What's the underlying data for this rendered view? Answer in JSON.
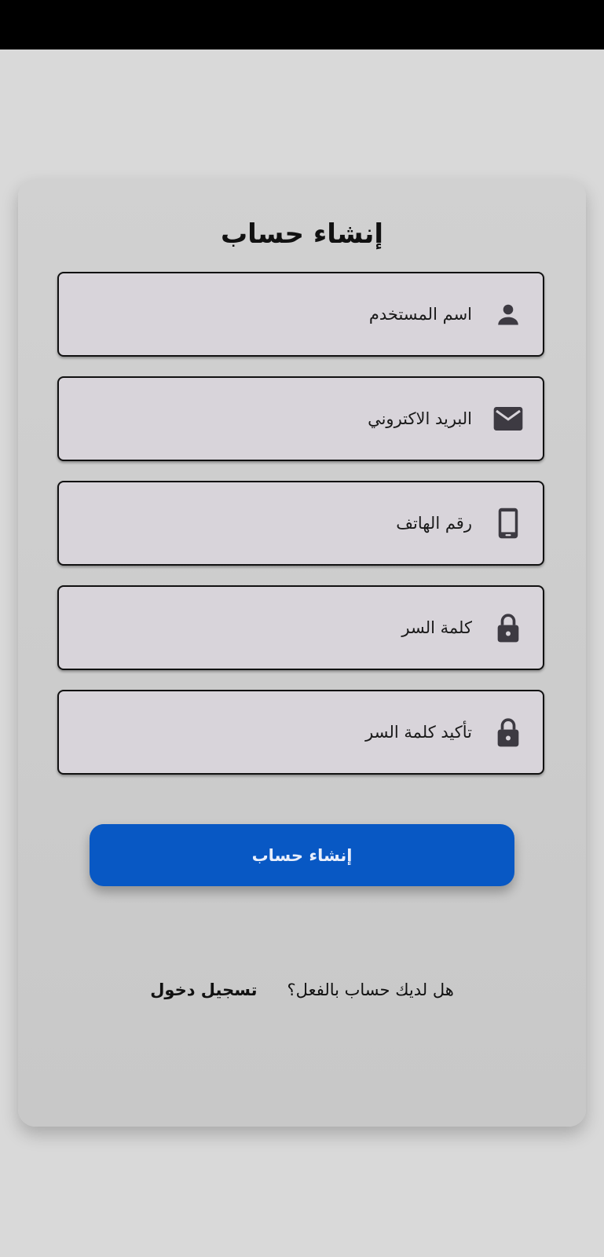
{
  "form": {
    "title": "إنشاء حساب",
    "fields": [
      {
        "placeholder": "اسم المستخدم",
        "icon": "person-icon"
      },
      {
        "placeholder": "البريد الاكتروني",
        "icon": "email-icon"
      },
      {
        "placeholder": "رقم الهاتف",
        "icon": "phone-icon"
      },
      {
        "placeholder": "كلمة السر",
        "icon": "lock-icon"
      },
      {
        "placeholder": "تأكيد كلمة السر",
        "icon": "lock-icon"
      }
    ],
    "submit_label": "إنشاء حساب"
  },
  "footer": {
    "prompt": "هل لديك حساب بالفعل؟",
    "login_link": "تسجيل دخول"
  },
  "colors": {
    "accent": "#0858c4",
    "background": "#d9d9d9",
    "field_fill": "#d8d4da",
    "icon": "#3d3a42"
  }
}
